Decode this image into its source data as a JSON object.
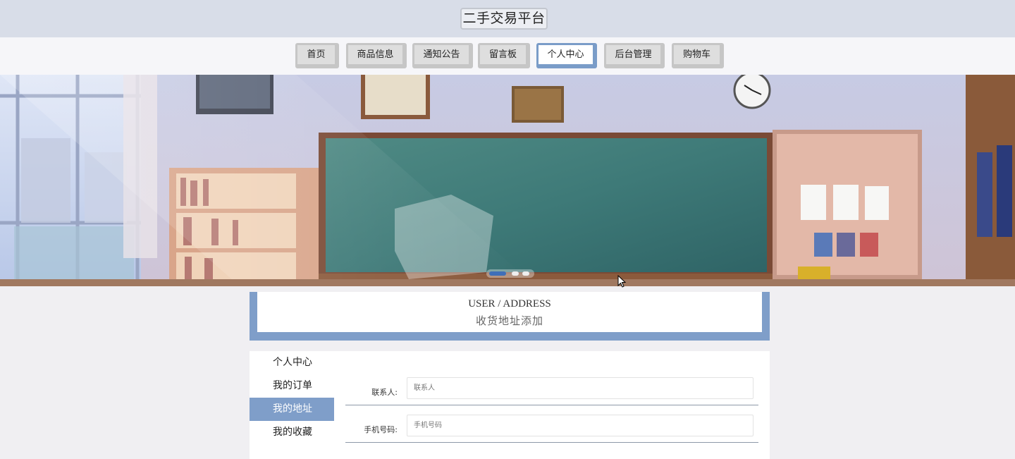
{
  "header": {
    "title": "二手交易平台"
  },
  "nav": {
    "items": [
      {
        "label": "首页"
      },
      {
        "label": "商品信息"
      },
      {
        "label": "通知公告"
      },
      {
        "label": "留言板"
      },
      {
        "label": "个人中心"
      },
      {
        "label": "后台管理"
      },
      {
        "label": "购物车"
      }
    ],
    "active": "个人中心"
  },
  "banner": {
    "image": "classroom-illustration",
    "active_slide": 1,
    "slide_count": 3
  },
  "page_head": {
    "en": "USER / ADDRESS",
    "zh": "收货地址添加"
  },
  "sidebar": {
    "items": [
      {
        "label": "个人中心"
      },
      {
        "label": "我的订单"
      },
      {
        "label": "我的地址"
      },
      {
        "label": "我的收藏"
      }
    ],
    "active": "我的地址"
  },
  "form": {
    "contact": {
      "label": "联系人:",
      "placeholder": "联系人",
      "value": ""
    },
    "phone": {
      "label": "手机号码:",
      "placeholder": "手机号码",
      "value": ""
    }
  },
  "colors": {
    "accent": "#7f9ec9",
    "topbar": "#d8dde8"
  }
}
